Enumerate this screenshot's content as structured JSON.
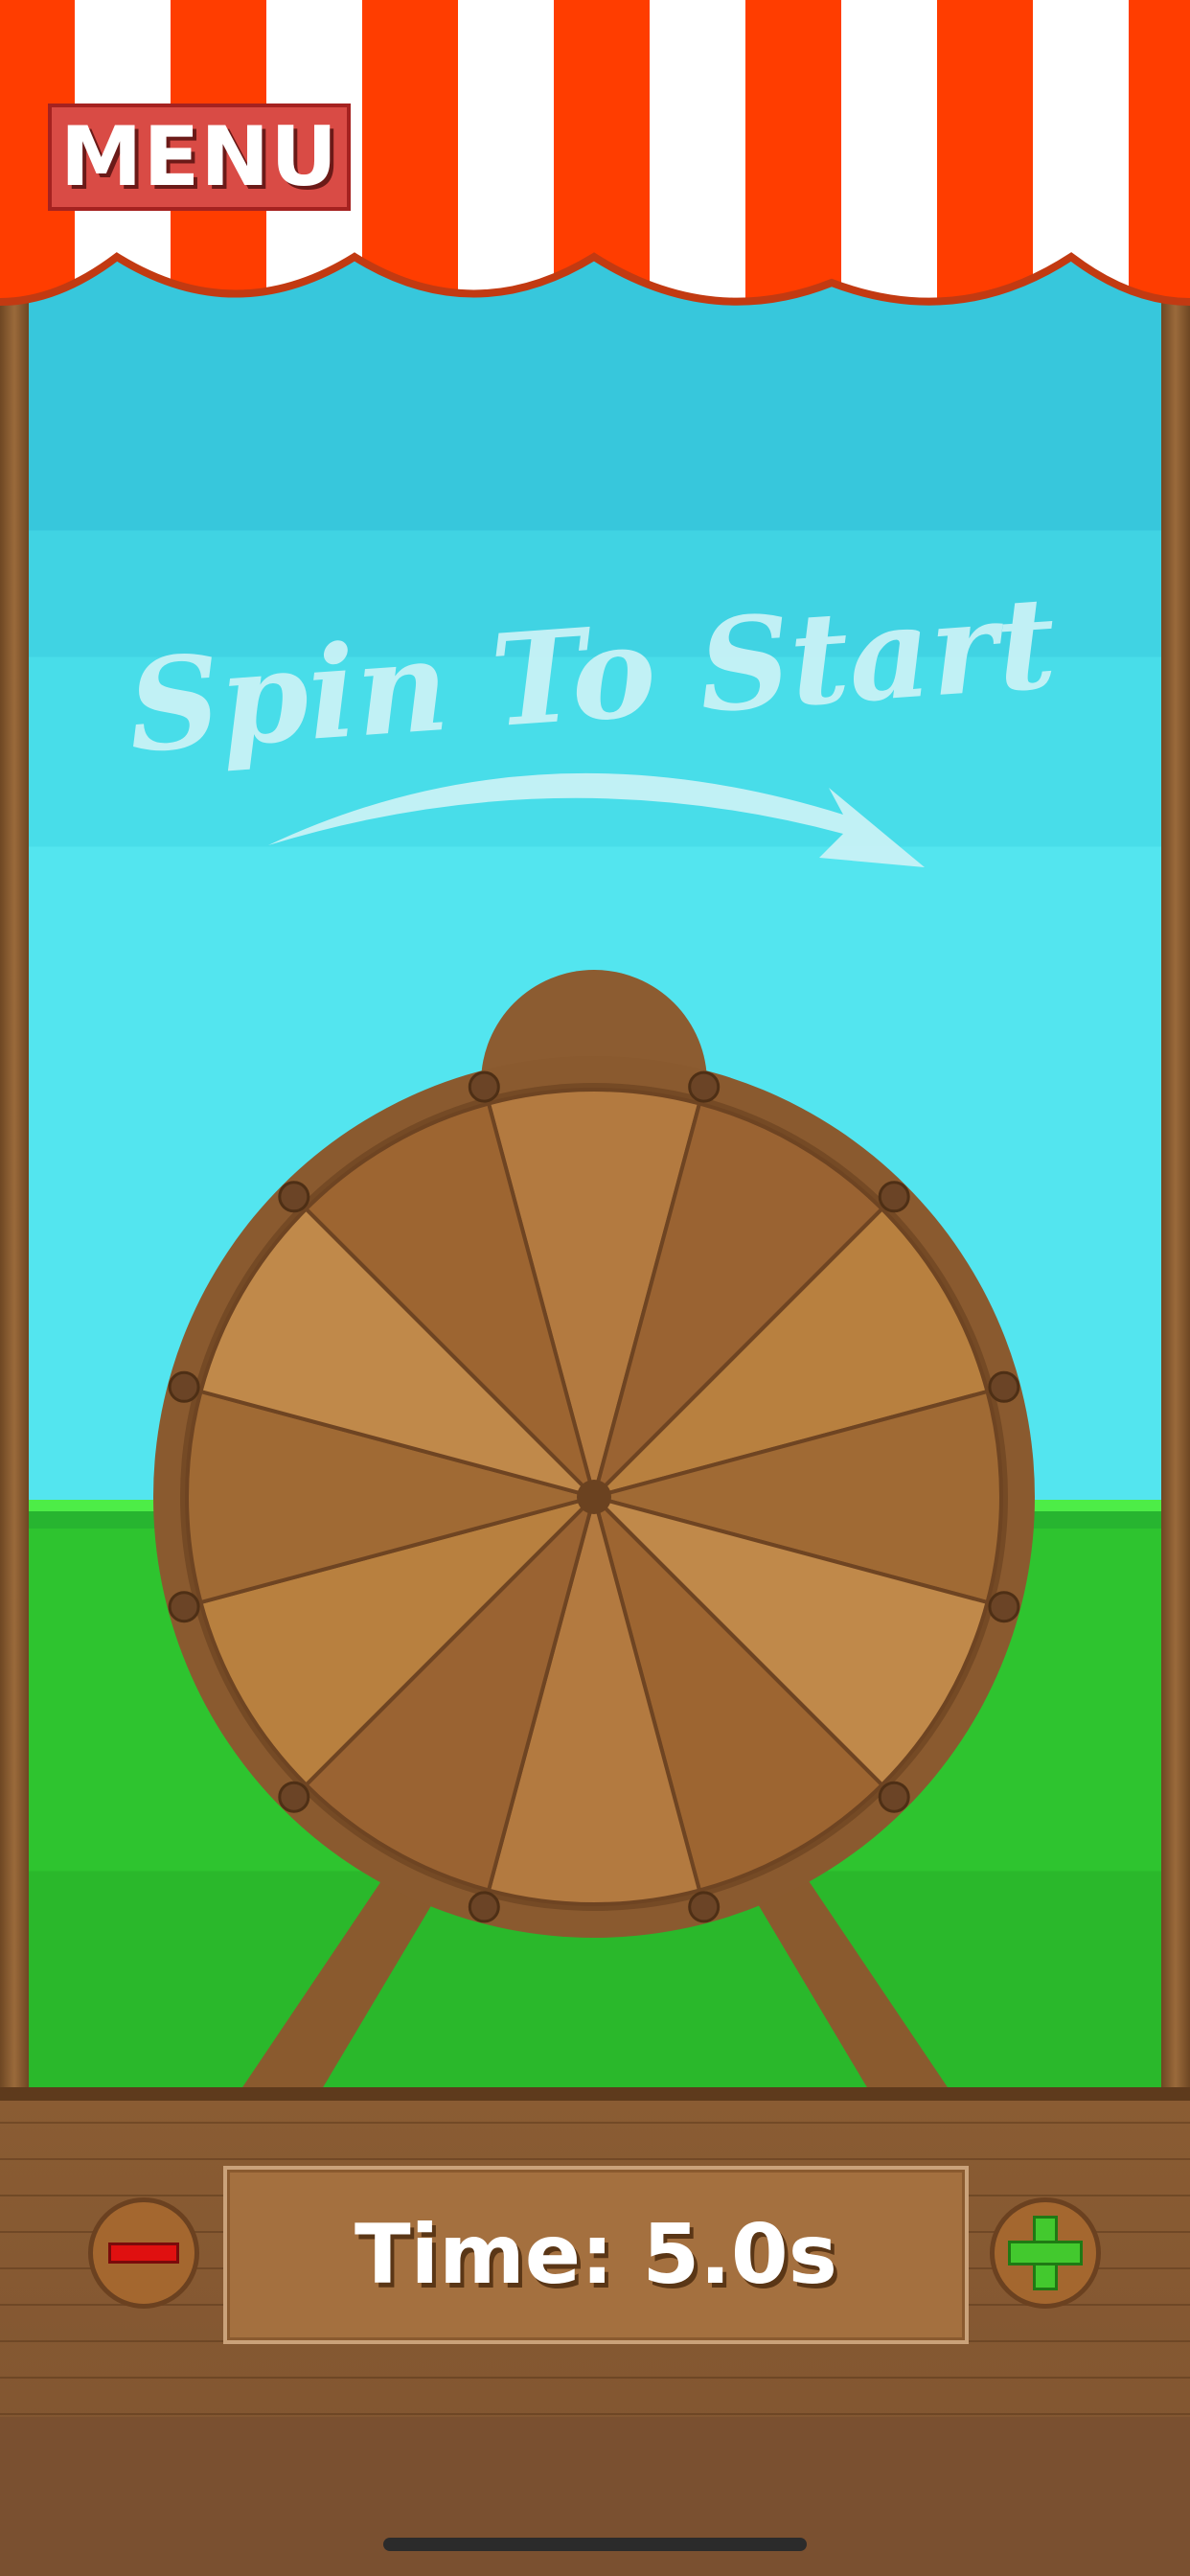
{
  "header": {
    "menu_label": "MENU"
  },
  "hint": {
    "text": "Spin To Start"
  },
  "wheel": {
    "segments": 12
  },
  "controls": {
    "time_label": "Time: 5.0s",
    "decrease_icon": "minus-icon",
    "increase_icon": "plus-icon"
  },
  "colors": {
    "awning_red": "#ff3d00",
    "awning_white": "#ffffff",
    "sky": "#48dde9",
    "grass": "#2ec42f",
    "wood": "#9b6331",
    "menu_red": "#d94b45"
  }
}
